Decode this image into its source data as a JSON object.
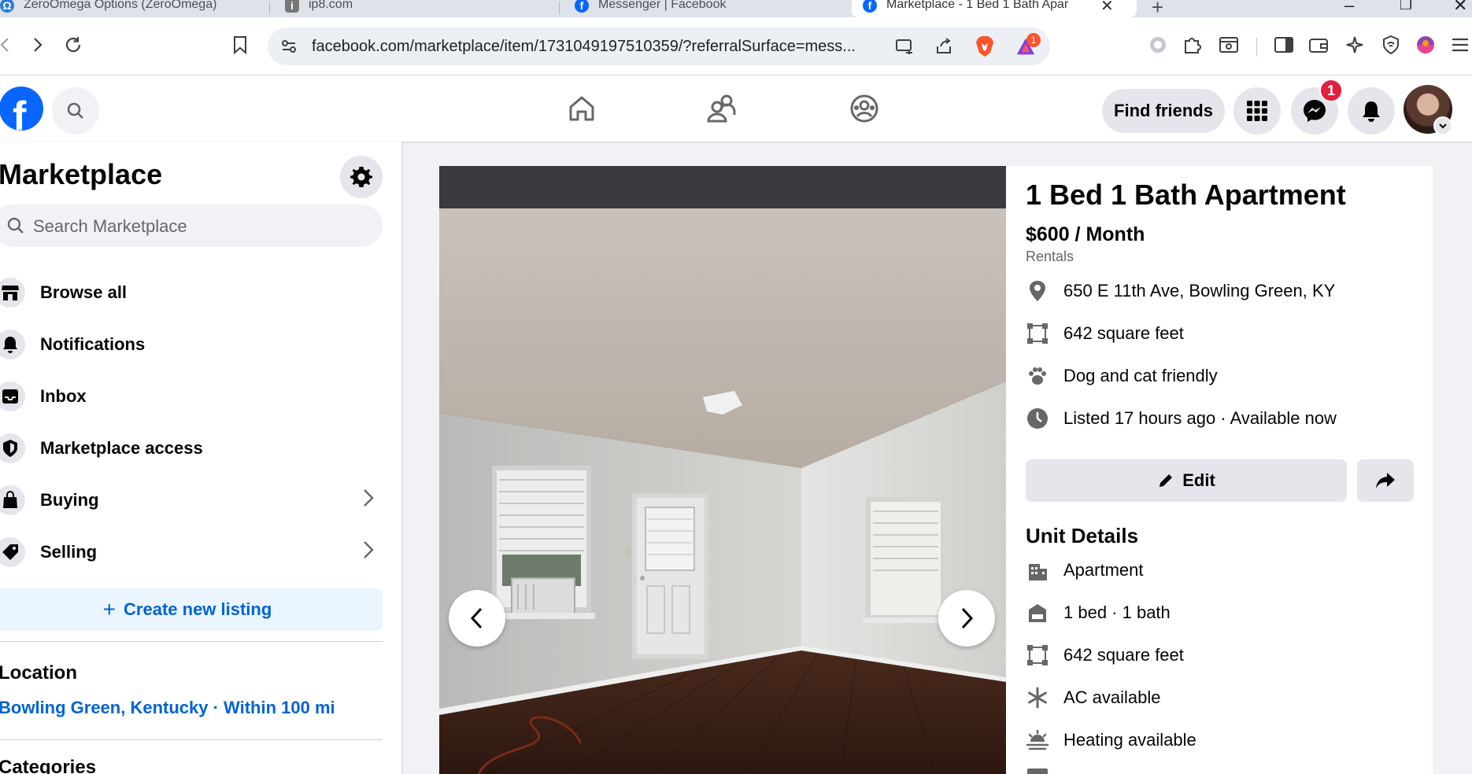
{
  "browser": {
    "tabs": [
      {
        "title": "ZeroOmega Options (ZeroOmega)"
      },
      {
        "title": "ip8.com"
      },
      {
        "title": "Messenger | Facebook"
      },
      {
        "title": "Marketplace - 1 Bed 1 Bath Apar"
      }
    ],
    "new_tab": "+",
    "url": "facebook.com/marketplace/item/1731049197510359/?referralSurface=mess...",
    "brave_rewards_count": "1"
  },
  "facebook": {
    "logo": "f",
    "find_friends_label": "Find friends",
    "messenger_badge": "1"
  },
  "sidebar": {
    "title": "Marketplace",
    "search_placeholder": "Search Marketplace",
    "items": [
      {
        "label": "Browse all",
        "icon": "storefront-icon"
      },
      {
        "label": "Notifications",
        "icon": "bell-icon"
      },
      {
        "label": "Inbox",
        "icon": "inbox-icon"
      },
      {
        "label": "Marketplace access",
        "icon": "shield-icon"
      },
      {
        "label": "Buying",
        "icon": "bag-icon"
      },
      {
        "label": "Selling",
        "icon": "tag-icon"
      }
    ],
    "create_listing_label": "Create new listing",
    "location_heading": "Location",
    "location_value": "Bowling Green, Kentucky · Within 100 mi",
    "categories_heading": "Categories"
  },
  "listing": {
    "title": "1 Bed 1 Bath Apartment",
    "price": "$600 / Month",
    "category": "Rentals",
    "facts": [
      {
        "icon": "location-pin-icon",
        "text": "650 E 11th Ave, Bowling Green, KY"
      },
      {
        "icon": "square-footage-icon",
        "text": "642 square feet"
      },
      {
        "icon": "paw-icon",
        "text": "Dog and cat friendly"
      },
      {
        "icon": "clock-icon",
        "text": "Listed 17 hours ago · Available now"
      }
    ],
    "edit_label": "Edit",
    "unit_details_heading": "Unit Details",
    "unit_details": [
      {
        "icon": "building-icon",
        "text": "Apartment"
      },
      {
        "icon": "bed-bath-icon",
        "text": "1 bed · 1 bath"
      },
      {
        "icon": "square-footage-icon",
        "text": "642 square feet"
      },
      {
        "icon": "snowflake-icon",
        "text": "AC available"
      },
      {
        "icon": "heating-icon",
        "text": "Heating available"
      }
    ]
  },
  "colors": {
    "facebook_blue": "#0866ff",
    "link_blue": "#0064d1",
    "badge_red": "#e41e3f",
    "brave_orange": "#fb542b"
  }
}
